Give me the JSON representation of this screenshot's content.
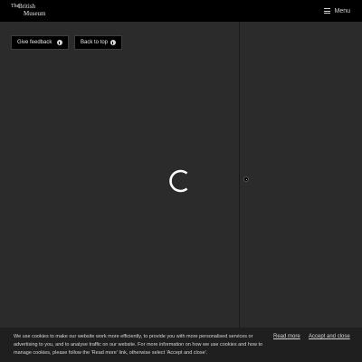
{
  "header": {
    "logo": {
      "line1": "The",
      "line2": "British",
      "line3": "Museum"
    },
    "menu_label": "Menu"
  },
  "actions": {
    "feedback_label": "Give feedback",
    "back_to_top_label": "Back to top"
  },
  "cookie_banner": {
    "text": "We use cookies to make our website work more efficiently, to provide you with more personalised services or advertising to you, and to analyse traffic on our website. For more information on how we use cookies and how to manage cookies, please follow the 'Read more' link, otherwise select 'Accept and close'.",
    "read_more_label": "Read more",
    "accept_label": "Accept and close"
  },
  "icons": {
    "menu": "hamburger-icon",
    "feedback": "circle-icon",
    "back_to_top": "arrow-up-circle-icon",
    "loading": "spinner-icon"
  },
  "colors": {
    "header_bg": "#000000",
    "page_bg": "#2b2b2b",
    "banner_bg": "#1f1f1f"
  }
}
